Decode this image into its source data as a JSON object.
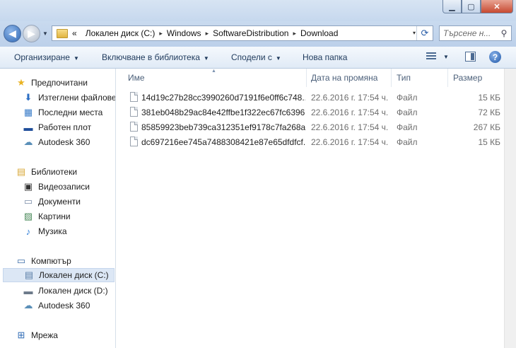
{
  "window": {
    "minimize_glyph": "▁",
    "maximize_glyph": "▢",
    "close_glyph": "✕"
  },
  "address": {
    "overflow": "«",
    "crumbs": [
      "Локален диск (C:)",
      "Windows",
      "SoftwareDistribution",
      "Download"
    ],
    "separator": "▸",
    "dropdown": "▾",
    "refresh_icon": "⟳"
  },
  "search": {
    "placeholder": "Търсене н..."
  },
  "toolbar": {
    "organize": "Организиране",
    "include_library": "Включване в библиотека",
    "share_with": "Сподели с",
    "new_folder": "Нова папка",
    "help": "?"
  },
  "nav": {
    "favorites": "Предпочитани",
    "downloads": "Изтеглени файлове",
    "recent": "Последни места",
    "desktop": "Работен плот",
    "autodesk1": "Autodesk 360",
    "libraries": "Библиотеки",
    "videos": "Видеозаписи",
    "documents": "Документи",
    "pictures": "Картини",
    "music": "Музика",
    "computer": "Компютър",
    "local_c": "Локален диск (C:)",
    "local_d": "Локален диск (D:)",
    "autodesk2": "Autodesk 360",
    "network": "Мрежа"
  },
  "columns": {
    "name": "Име",
    "date": "Дата на промяна",
    "type": "Тип",
    "size": "Размер"
  },
  "files": [
    {
      "name": "14d19c27b28cc3990260d7191f6e0ff6c748...",
      "date": "22.6.2016 г. 17:54 ч.",
      "type": "Файл",
      "size": "15 КБ"
    },
    {
      "name": "381eb048b29ac84e42ffbe1f322ec67fc6396...",
      "date": "22.6.2016 г. 17:54 ч.",
      "type": "Файл",
      "size": "72 КБ"
    },
    {
      "name": "85859923beb739ca312351ef9178c7fa268a...",
      "date": "22.6.2016 г. 17:54 ч.",
      "type": "Файл",
      "size": "267 КБ"
    },
    {
      "name": "dc697216ee745a7488308421e87e65dfdfcf...",
      "date": "22.6.2016 г. 17:54 ч.",
      "type": "Файл",
      "size": "15 КБ"
    }
  ]
}
